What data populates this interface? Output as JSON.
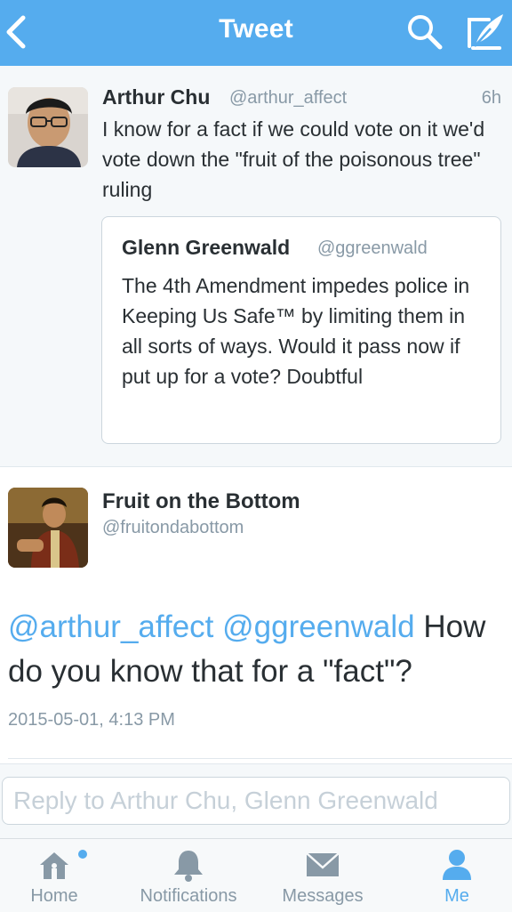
{
  "header": {
    "title": "Tweet",
    "back_icon": "chevron-left-icon",
    "search_icon": "search-icon",
    "compose_icon": "compose-icon",
    "bg_color": "#55acee"
  },
  "context_tweet": {
    "author_name": "Arthur Chu",
    "author_handle": "@arthur_affect",
    "time": "6h",
    "text": "I know for a fact if we could vote on it we'd vote down the \"fruit of the poisonous tree\" ruling",
    "quoted": {
      "author_name": "Glenn Greenwald",
      "author_handle": "@ggreenwald",
      "text": "The 4th Amendment impedes police in Keeping Us Safe™ by limiting them in all sorts of ways. Would it pass now if put up for a vote? Doubtful"
    }
  },
  "main_tweet": {
    "author_name": "Fruit on the Bottom",
    "author_handle": "@fruitondabottom",
    "mention_1": "@arthur_affect",
    "mention_2": "@ggreenwald",
    "text_rest": "How do you know that for a \"fact\"?",
    "timestamp": "2015-05-01, 4:13 PM"
  },
  "reply": {
    "placeholder": "Reply to Arthur Chu, Glenn Greenwald"
  },
  "tabbar": {
    "tabs": [
      {
        "label": "Home",
        "icon": "home-icon"
      },
      {
        "label": "Notifications",
        "icon": "bell-icon"
      },
      {
        "label": "Messages",
        "icon": "envelope-icon"
      },
      {
        "label": "Me",
        "icon": "person-icon"
      }
    ],
    "active_tab": "Me",
    "accent_color": "#55acee",
    "inactive_color": "#8899a6"
  }
}
